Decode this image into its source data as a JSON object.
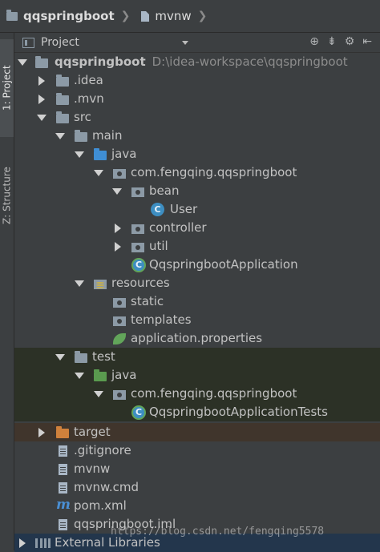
{
  "breadcrumb": {
    "project": "qqspringboot",
    "file": "mvnw"
  },
  "tool_strip": {
    "project_tab": "1: Project",
    "structure_tab": "Z: Structure"
  },
  "panel": {
    "view_label": "Project"
  },
  "tree": {
    "root_name": "qqspringboot",
    "root_path": "D:\\idea-workspace\\qqspringboot",
    "idea": ".idea",
    "mvn": ".mvn",
    "src": "src",
    "main": "main",
    "main_java": "java",
    "main_pkg": "com.fengqing.qqspringboot",
    "bean": "bean",
    "user": "User",
    "controller": "controller",
    "util": "util",
    "app": "QqspringbootApplication",
    "resources": "resources",
    "static": "static",
    "templates": "templates",
    "props": "application.properties",
    "test": "test",
    "test_java": "java",
    "test_pkg": "com.fengqing.qqspringboot",
    "tests_class": "QqspringbootApplicationTests",
    "target": "target",
    "gitignore": ".gitignore",
    "mvnw": "mvnw",
    "mvnw_cmd": "mvnw.cmd",
    "pom": "pom.xml",
    "iml": "qqspringboot.iml",
    "ext_libs": "External Libraries"
  },
  "icons": {
    "class_letter": "C",
    "maven_letter": "m"
  },
  "watermark": "https://blog.csdn.net/fengqing5578",
  "colors": {
    "background": "#3c3f41",
    "source_folder": "#3f8ed4",
    "test_folder": "#5a9b4f",
    "excluded_folder": "#d0813c"
  }
}
